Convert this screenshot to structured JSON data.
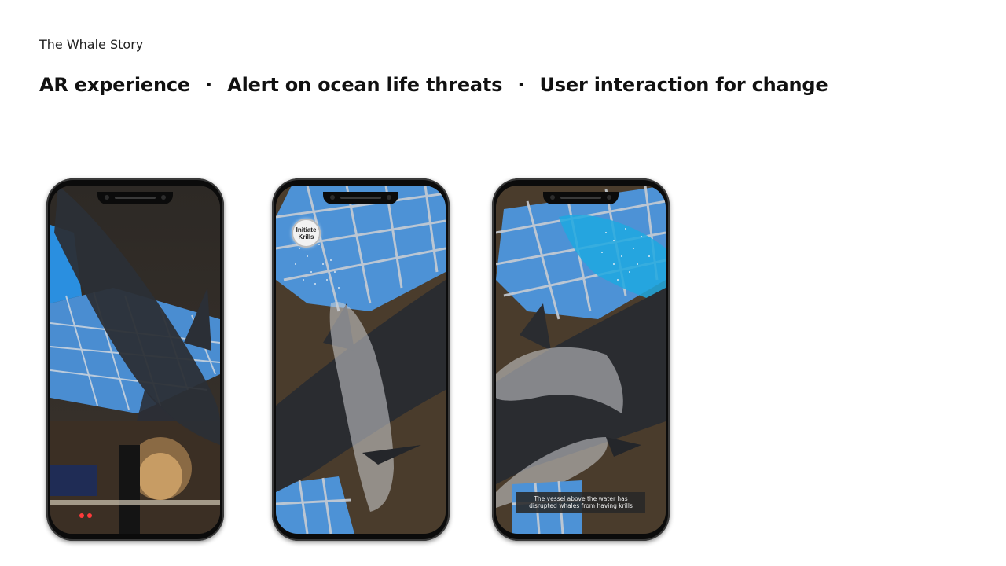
{
  "header": {
    "eyebrow": "The Whale Story",
    "headline_items": [
      "AR experience",
      "Alert on ocean life threats",
      "User interaction for change"
    ],
    "separator": "·"
  },
  "phones": [
    {
      "description_icon": "phone-screen-whale-skylight"
    },
    {
      "description_icon": "phone-screen-whale-krill",
      "krill_button_label_line1": "Initiate",
      "krill_button_label_line2": "Krills"
    },
    {
      "description_icon": "phone-screen-whale-vessel",
      "caption_line1": "The vessel above the water has",
      "caption_line2": "disrupted whales from having krills"
    }
  ],
  "colors": {
    "sky_blue": "#3f8fd8",
    "ceiling_dark": "#2a2520",
    "whale_dark": "#2b2e33",
    "whale_ghost": "#c9cbcf",
    "phone_frame": "#0b0b0b"
  }
}
